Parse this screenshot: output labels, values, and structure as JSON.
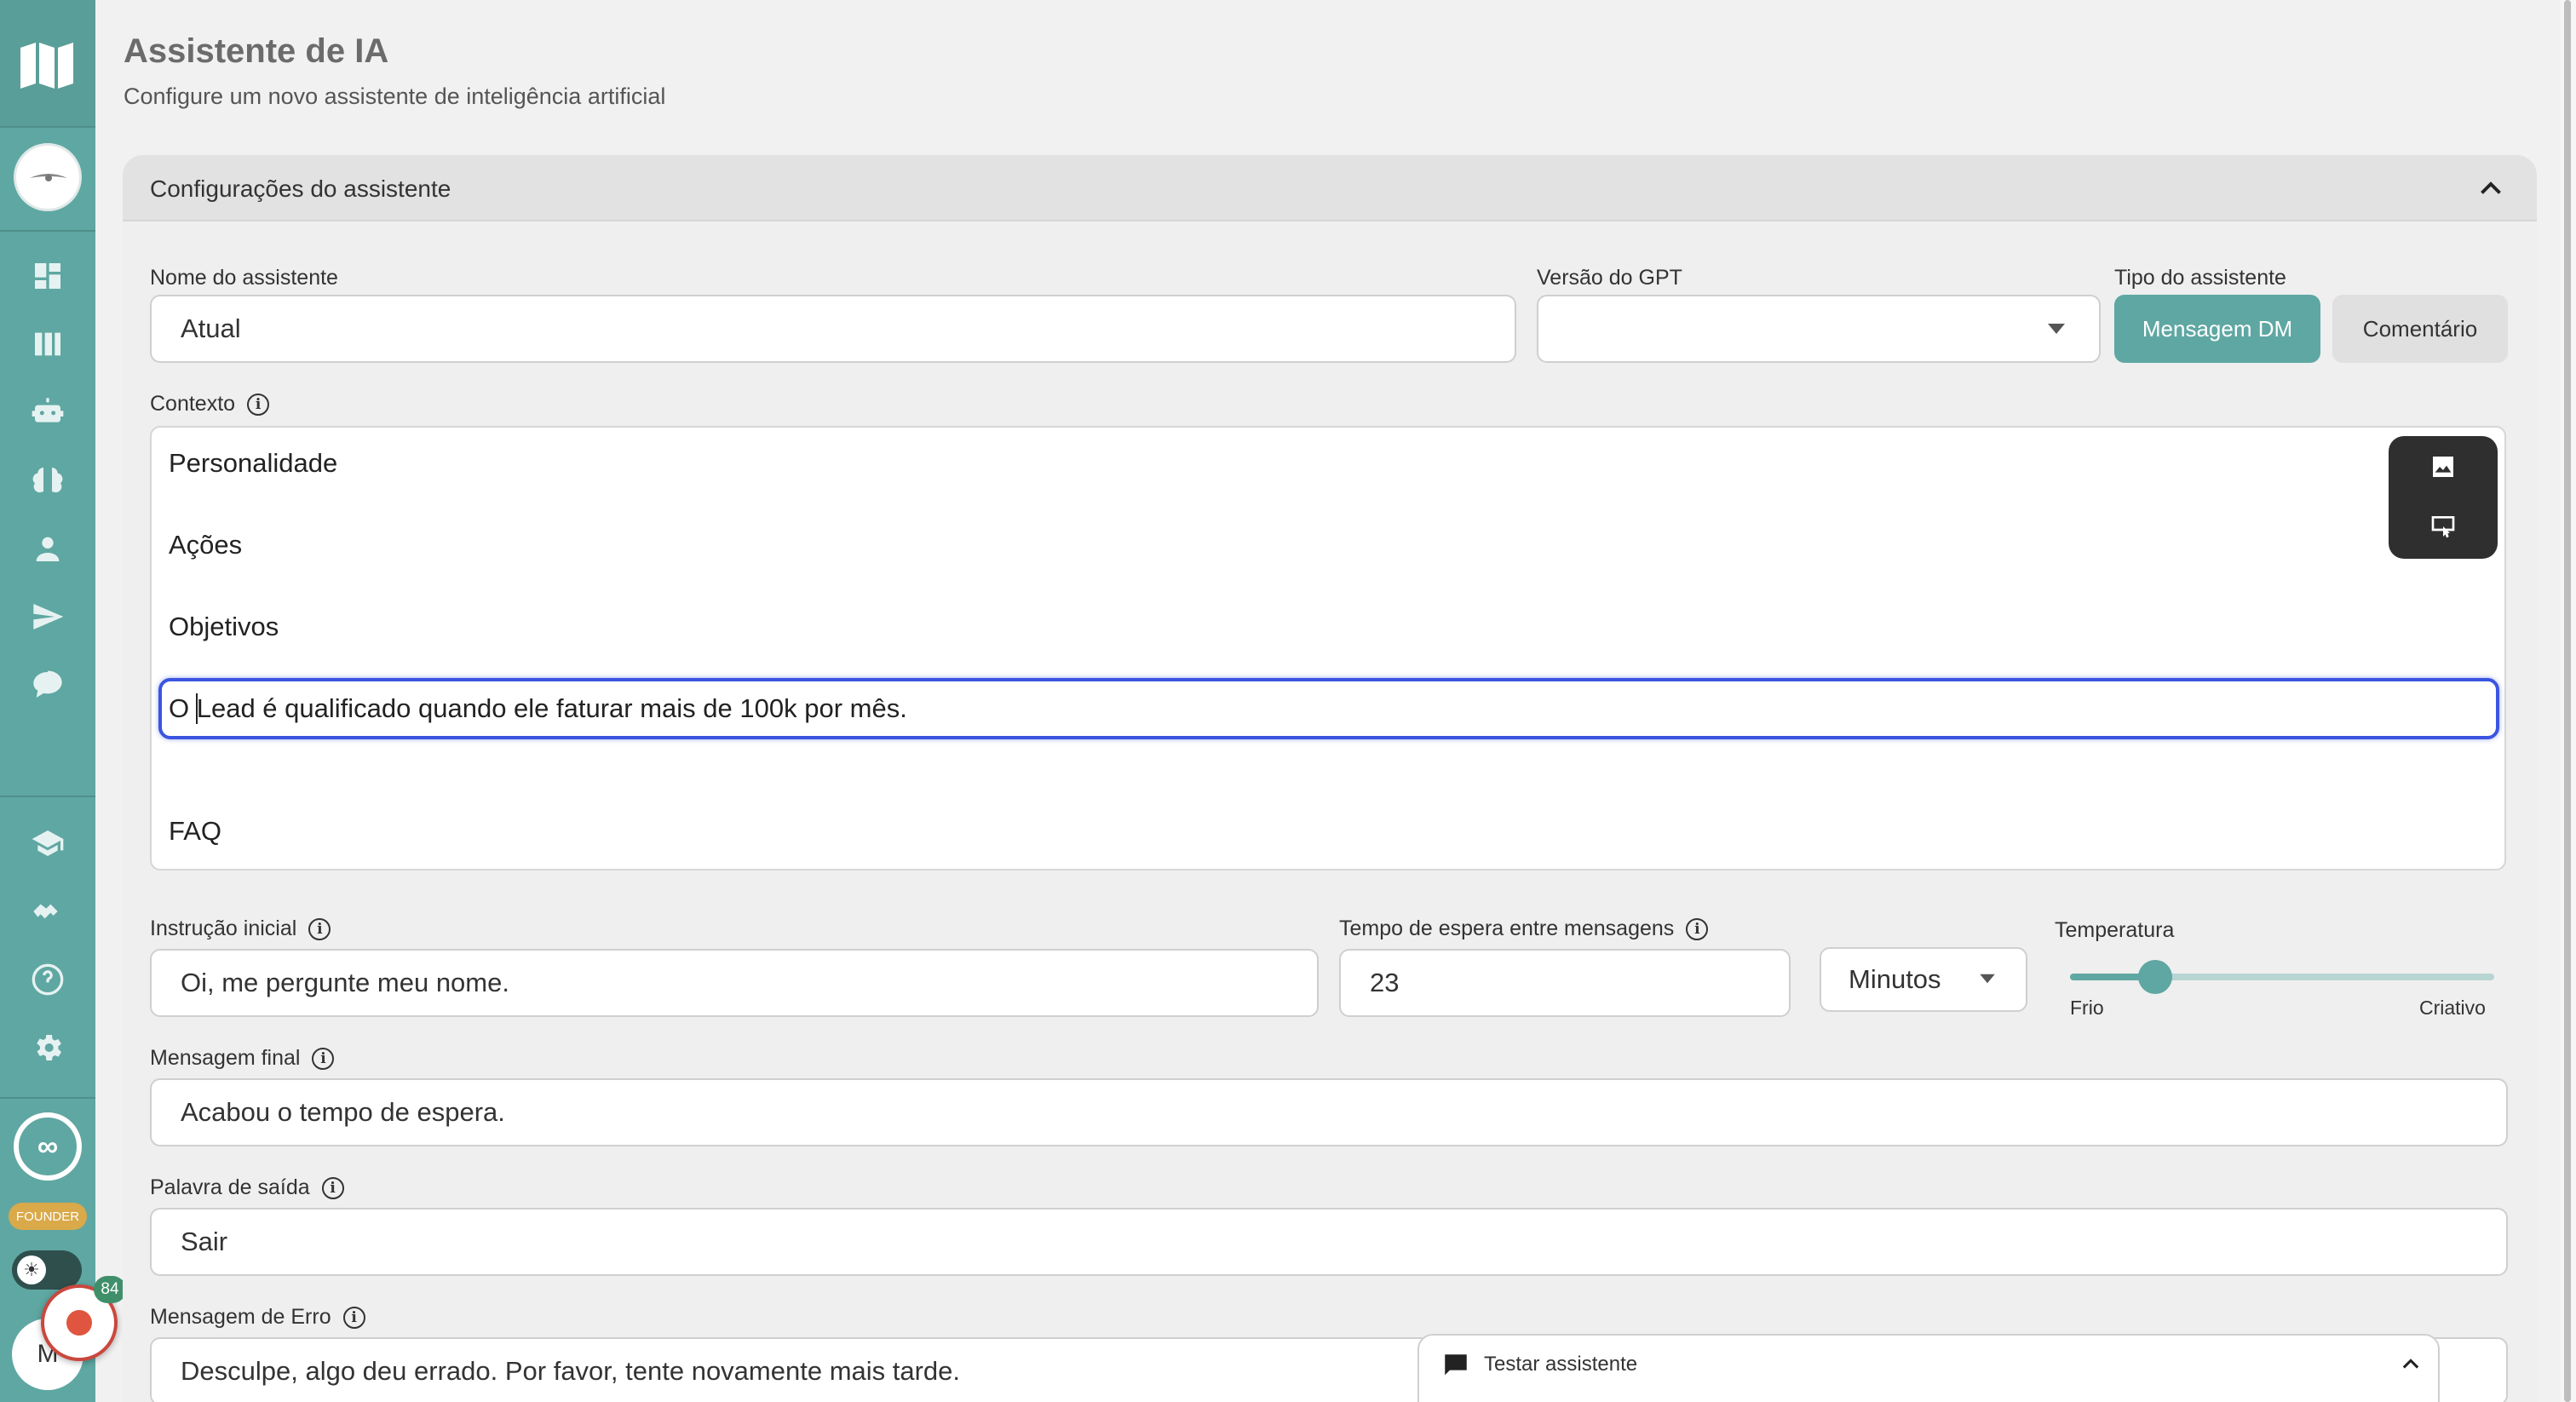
{
  "header": {
    "title": "Assistente de IA",
    "subtitle": "Configure um novo assistente de inteligência artificial"
  },
  "accordion": {
    "title": "Configurações do assistente",
    "expanded": true
  },
  "form": {
    "name_label": "Nome do assistente",
    "name_value": "Atual",
    "gpt_label": "Versão do GPT",
    "gpt_value": "",
    "type_label": "Tipo do assistente",
    "type_options": [
      "Mensagem DM",
      "Comentário"
    ],
    "type_selected": "Mensagem DM",
    "context_label": "Contexto",
    "context_lines": [
      "Personalidade",
      "Ações",
      "Objetivos",
      "O Lead é qualificado quando ele faturar mais de 100k por mês.",
      "FAQ"
    ],
    "initial_label": "Instrução inicial",
    "initial_value": "Oi, me pergunte meu nome.",
    "wait_label": "Tempo de espera entre mensagens",
    "wait_value": "23",
    "wait_unit": "Minutos",
    "temp_label": "Temperatura",
    "temp_min_label": "Frio",
    "temp_max_label": "Criativo",
    "temp_value": 0.2,
    "final_label": "Mensagem final",
    "final_value": "Acabou o tempo de espera.",
    "exit_label": "Palavra de saída",
    "exit_value": "Sair",
    "error_label": "Mensagem de Erro",
    "error_value": "Desculpe, algo deu errado. Por favor, tente novamente mais tarde."
  },
  "test_panel": {
    "label": "Testar assistente"
  },
  "sidebar": {
    "badge": "FOUNDER",
    "avatar_letter": "M",
    "notification_count": "84",
    "infinity": "∞"
  },
  "colors": {
    "accent": "#5fa7a2",
    "focus": "#3b55e0"
  }
}
